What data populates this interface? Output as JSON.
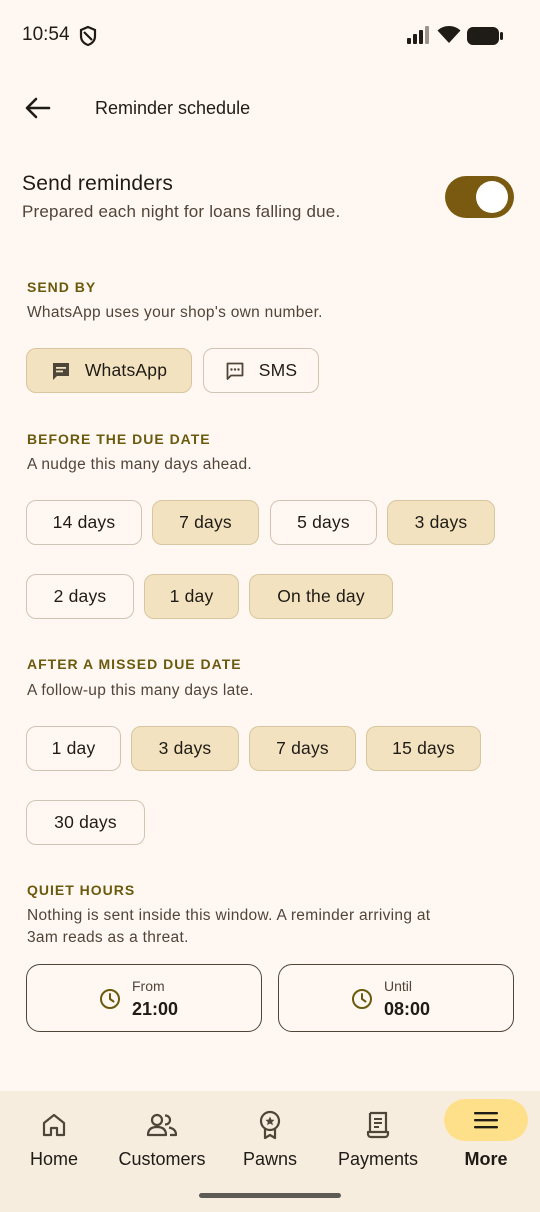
{
  "status_bar": {
    "time": "10:54"
  },
  "top_bar": {
    "title": "Reminder schedule"
  },
  "send_reminders": {
    "title": "Send reminders",
    "subtitle": "Prepared each night for loans falling due.",
    "enabled": true
  },
  "send_by": {
    "label": "SEND BY",
    "description": "WhatsApp uses your shop's own number.",
    "options": [
      {
        "label": "WhatsApp",
        "icon": "chat-icon",
        "selected": true
      },
      {
        "label": "SMS",
        "icon": "sms-icon",
        "selected": false
      }
    ]
  },
  "before_due": {
    "label": "BEFORE THE DUE DATE",
    "description": "A nudge this many days ahead.",
    "options": [
      {
        "label": "14 days",
        "selected": false
      },
      {
        "label": "7 days",
        "selected": true
      },
      {
        "label": "5 days",
        "selected": false
      },
      {
        "label": "3 days",
        "selected": true
      },
      {
        "label": "2 days",
        "selected": false
      },
      {
        "label": "1 day",
        "selected": true
      },
      {
        "label": "On the day",
        "selected": true
      }
    ]
  },
  "after_missed": {
    "label": "AFTER A MISSED DUE DATE",
    "description": "A follow-up this many days late.",
    "options": [
      {
        "label": "1 day",
        "selected": false
      },
      {
        "label": "3 days",
        "selected": true
      },
      {
        "label": "7 days",
        "selected": true
      },
      {
        "label": "15 days",
        "selected": true
      },
      {
        "label": "30 days",
        "selected": false
      }
    ]
  },
  "quiet_hours": {
    "label": "QUIET HOURS",
    "description_line1": "Nothing is sent inside this window. A reminder arriving at",
    "description_line2": "3am reads as a threat.",
    "from": {
      "label": "From",
      "value": "21:00"
    },
    "until": {
      "label": "Until",
      "value": "08:00"
    }
  },
  "bottom_nav": {
    "items": [
      {
        "label": "Home",
        "icon": "home-icon",
        "active": false
      },
      {
        "label": "Customers",
        "icon": "customers-icon",
        "active": false
      },
      {
        "label": "Pawns",
        "icon": "pawn-badge-icon",
        "active": false
      },
      {
        "label": "Payments",
        "icon": "receipt-icon",
        "active": false
      },
      {
        "label": "More",
        "icon": "menu-icon",
        "active": true
      }
    ]
  },
  "colors": {
    "background": "#FFF8F2",
    "accent": "#7A5A10",
    "selected_chip": "#F3E2BF",
    "section_label": "#6B5A0E",
    "nav_active": "#FFE08A"
  }
}
